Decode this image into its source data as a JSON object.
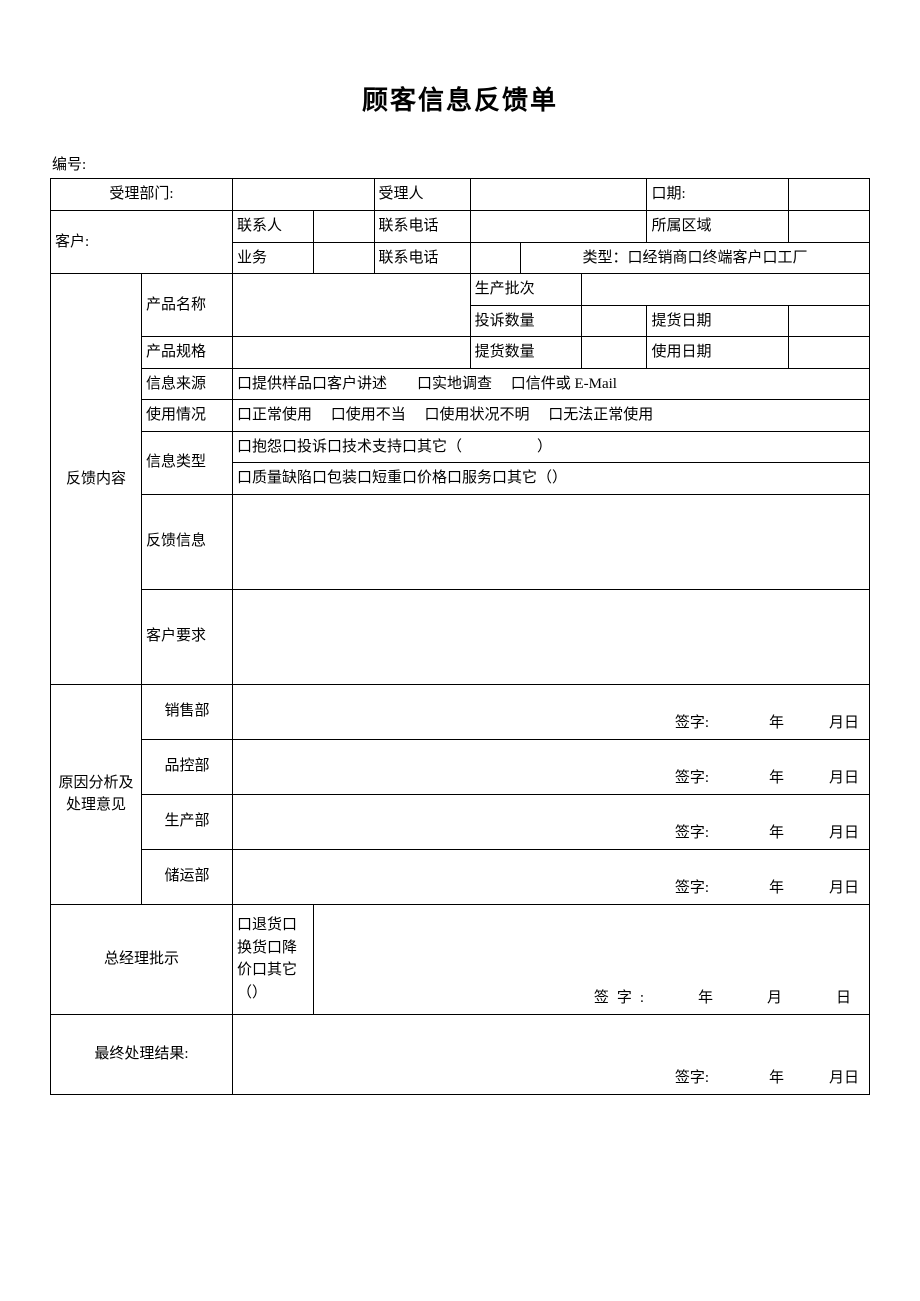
{
  "title": "顾客信息反馈单",
  "serial_label": "编号:",
  "row1": {
    "dept_label": "受理部门:",
    "person_label": "受理人",
    "date_label": "口期:"
  },
  "row2": {
    "customer_label": "客户:",
    "contact_label": "联系人",
    "phone_label": "联系电话",
    "region_label": "所属区域"
  },
  "row3": {
    "biz_label": "业务",
    "phone_label": "联系电话",
    "type_label": "类型：口经销商口终端客户口工厂"
  },
  "feedback": {
    "section_label": "反馈内容",
    "product_name": "产品名称",
    "batch": "生产批次",
    "complaint_qty": "投诉数量",
    "pickup_date": "提货日期",
    "product_spec": "产品规格",
    "pickup_qty": "提货数量",
    "use_date": "使用日期",
    "info_source_label": "信息来源",
    "info_source_value": "口提供样品口客户讲述　　口实地调查　 口信件或 E-Mail",
    "usage_label": "使用情况",
    "usage_value": "口正常使用　 口使用不当　 口使用状况不明　 口无法正常使用",
    "info_type_label": "信息类型",
    "info_type_line1": "口抱怨口投诉口技术支持口其它（　　　　　）",
    "info_type_line2": "口质量缺陷口包装口短重口价格口服务口其它（）",
    "feedback_info_label": "反馈信息",
    "customer_req_label": "客户要求"
  },
  "analysis": {
    "section_label": "原因分析及处理意见",
    "sales": "销售部",
    "qc": "品控部",
    "prod": "生产部",
    "logistics": "储运部",
    "sign_text": "签字:　　　　年　　　月日"
  },
  "gm": {
    "label": "总经理批示",
    "options": "口退货口换货口降价口其它（）",
    "sign_text": "签字:　　年　　月　　日"
  },
  "final": {
    "label": "最终处理结果:",
    "sign_text": "签字:　　　　年　　　月日"
  }
}
